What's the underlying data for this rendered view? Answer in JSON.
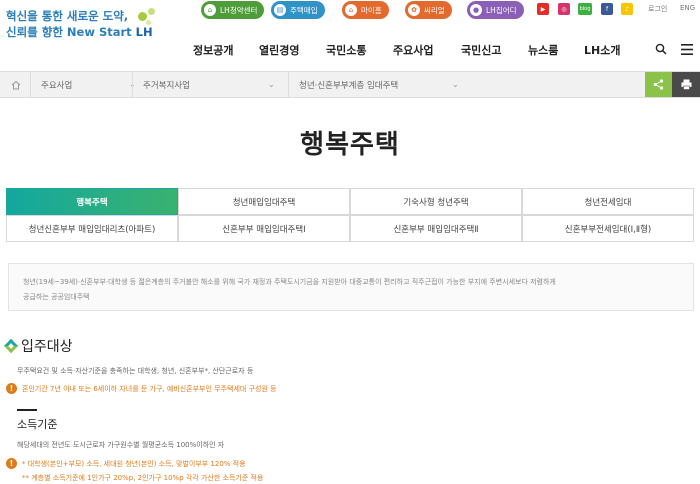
{
  "logo": {
    "line1": "혁신을 통한 새로운 도약,",
    "line2_prefix": "신뢰를 향한 New Start ",
    "brand": "LH"
  },
  "quick_links": [
    {
      "label": "LH청약센터",
      "icon": "home-icon",
      "color": "#4f9c3a"
    },
    {
      "label": "주택매입",
      "icon": "building-icon",
      "color": "#2f93c7"
    },
    {
      "label": "마이홈",
      "icon": "house-icon",
      "color": "#e4692c"
    },
    {
      "label": "씨리얼",
      "icon": "cereal-icon",
      "color": "#e4692c"
    },
    {
      "label": "LH집어디",
      "icon": "map-pin-icon",
      "color": "#8a5fb5"
    }
  ],
  "sns": [
    {
      "name": "youtube-icon",
      "glyph": "▶",
      "color": "#e52d27"
    },
    {
      "name": "instagram-icon",
      "glyph": "◎",
      "color": "#d6336c"
    },
    {
      "name": "blog-icon",
      "glyph": "blog",
      "color": "#3cb043"
    },
    {
      "name": "facebook-icon",
      "glyph": "f",
      "color": "#3b5998"
    },
    {
      "name": "kakao-icon",
      "glyph": "♪",
      "color": "#f7c600"
    }
  ],
  "top_utility": {
    "login": "로그인",
    "lang": "ENG"
  },
  "gnb": [
    "정보공개",
    "열린경영",
    "국민소통",
    "주요사업",
    "국민신고",
    "뉴스룸",
    "LH소개"
  ],
  "breadcrumb": [
    "주요사업",
    "주거복지사업",
    "청년·신혼부부계층 임대주택"
  ],
  "page_title": "행복주택",
  "tabs_row1": [
    "행복주택",
    "청년매입임대주택",
    "기숙사형 청년주택",
    "청년전세임대"
  ],
  "tabs_row2": [
    "청년신혼부부 매입임대리츠(아파트)",
    "신혼부부 매입임대주택Ⅰ",
    "신혼부부 매입임대주택Ⅱ",
    "신혼부부전세임대(Ⅰ,Ⅱ형)"
  ],
  "intro": {
    "line1": "청년(19세~39세)·신혼부부·대학생 등 젊은계층의 주거불안 해소를 위해 국가 재정과 주택도시기금을 지원받아 대중교통이 편리하고 직주근접이 가능한 부지에 주변시세보다 저렴하게",
    "line2": "공급하는 공공임대주택"
  },
  "section": {
    "title": "입주대상",
    "desc": "무주택요건 및 소득·자산기준을 충족하는 대학생, 청년, 신혼부부*, 산단근로자 등",
    "warning1": "혼인기간 7년 이내 또는 6세이하 자녀를 둔 가구, 예비신혼부부인 무주택세대 구성원 등",
    "subtitle": "소득기준",
    "income_desc": "해당세대의 전년도 도시근로자 가구원수별 월평균소득 100%이하인 자",
    "warning2a": "* 대학생(본인+부모) 소득, 세대원 청년(본인) 소득, 맞벌이부부 120% 적용",
    "warning2b": "** 계층별 소득기준에 1인가구 20%p, 2인가구 10%p 각각 가산한 소득기준 적용"
  }
}
